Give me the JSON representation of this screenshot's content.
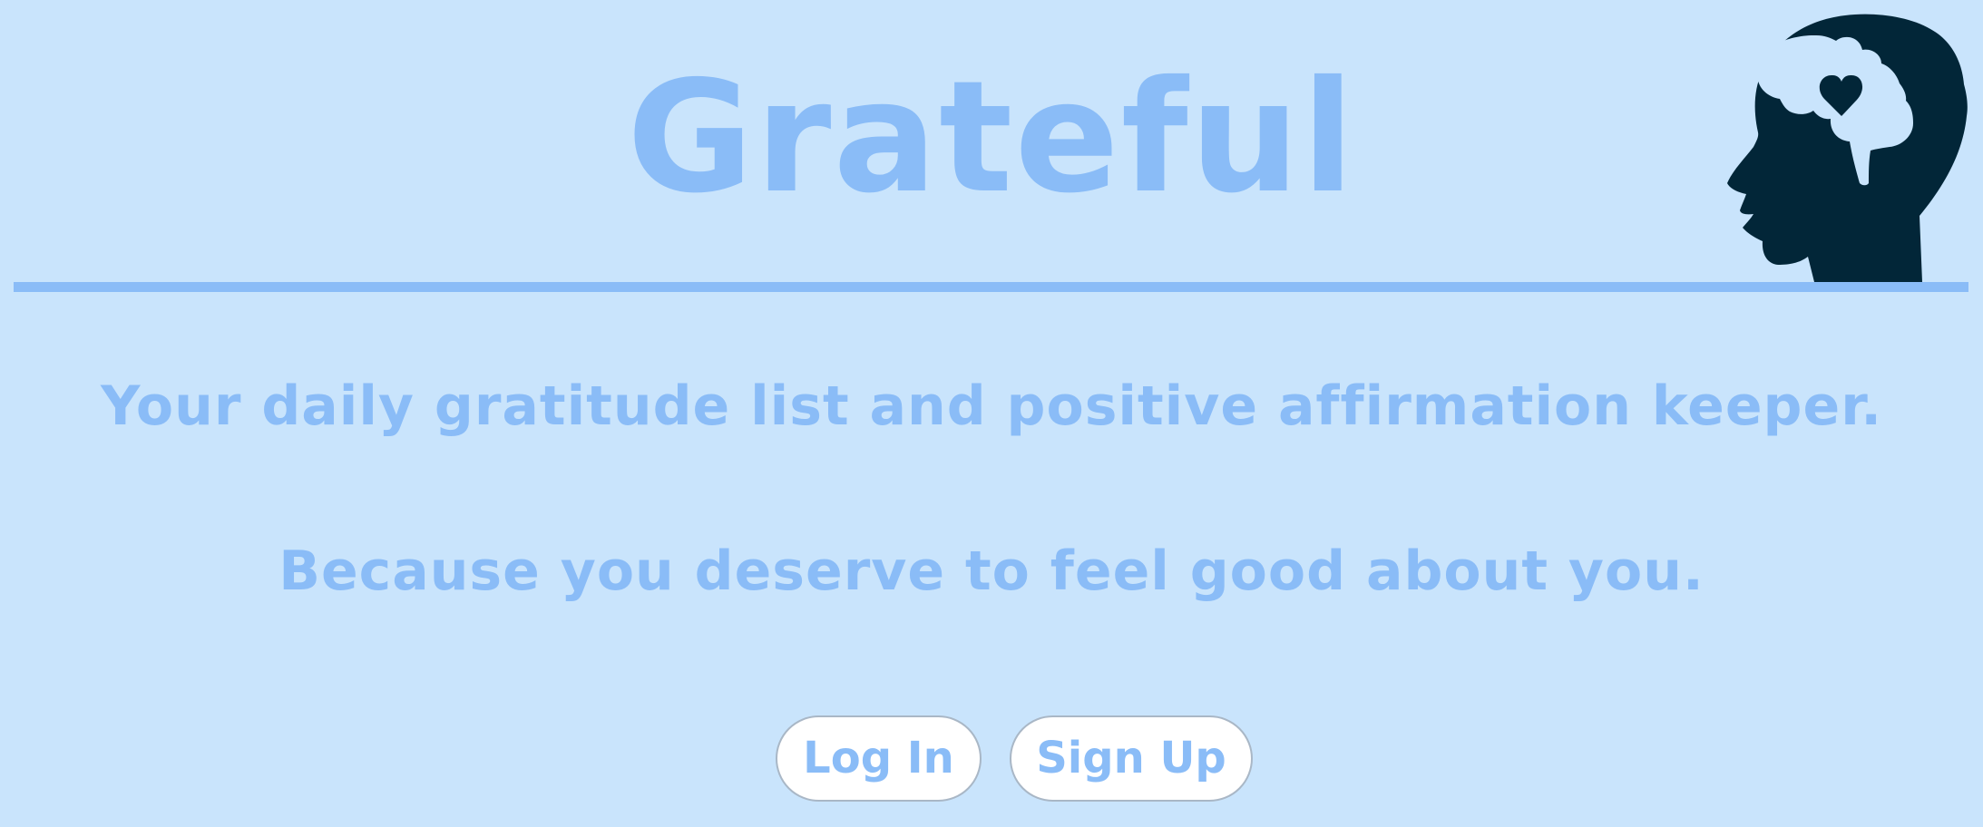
{
  "header": {
    "title": "Grateful",
    "logo_icon": "head-brain-heart-icon"
  },
  "hero": {
    "tagline": "Your daily gratitude list and positive affirmation keeper.",
    "subtagline": "Because you deserve to feel good about you."
  },
  "actions": {
    "login_label": "Log In",
    "signup_label": "Sign Up"
  },
  "colors": {
    "background": "#c9e4fc",
    "accent": "#8abcf7",
    "logo": "#022638",
    "button_bg": "#ffffff"
  }
}
